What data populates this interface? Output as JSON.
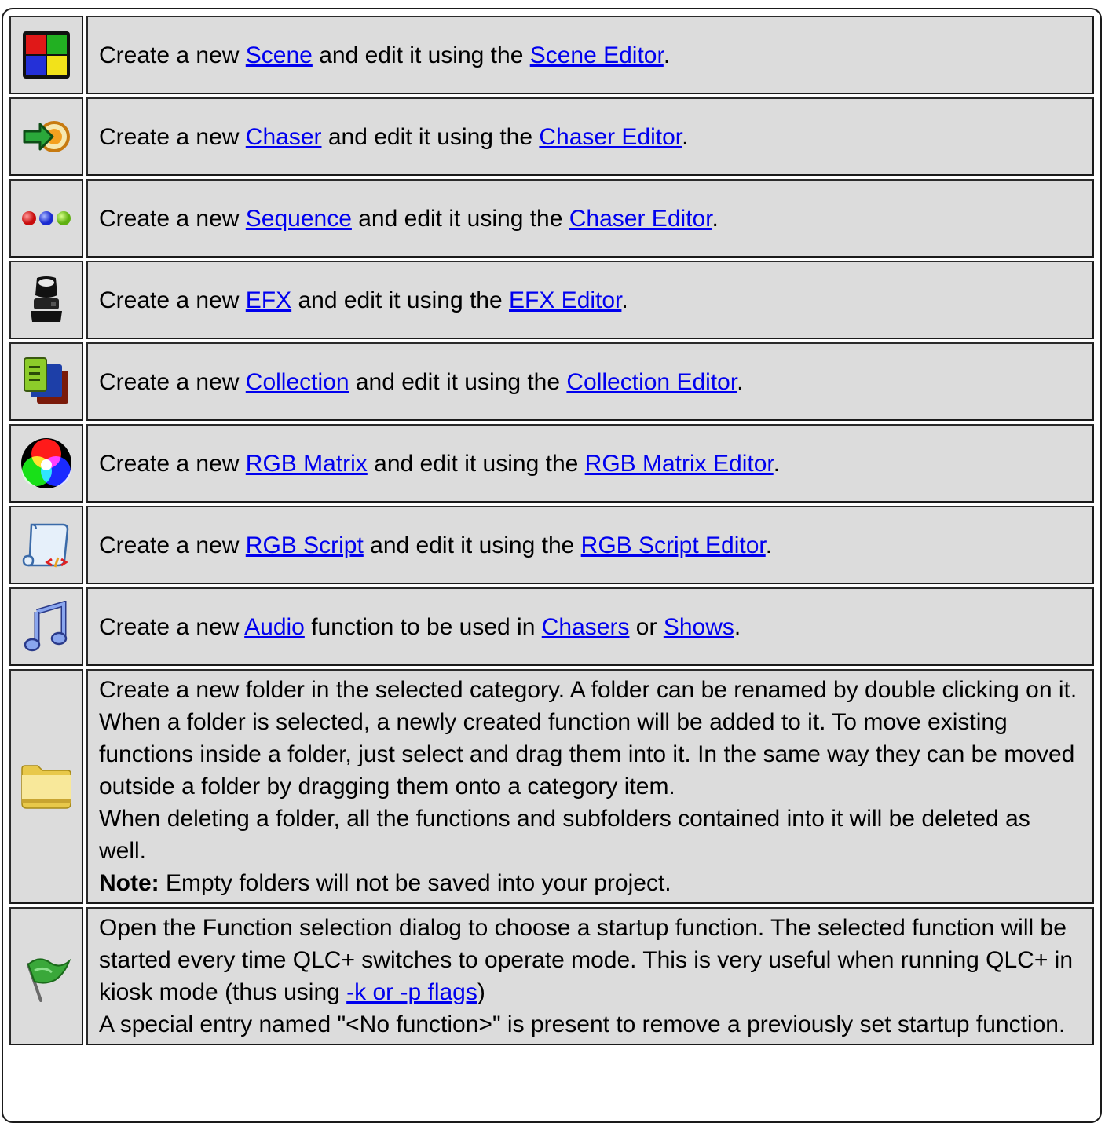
{
  "rows": [
    {
      "icon": "scene-icon",
      "prefix": "Create a new ",
      "link1": "Scene",
      "middle": " and edit it using the ",
      "link2": "Scene Editor",
      "suffix": "."
    },
    {
      "icon": "chaser-icon",
      "prefix": "Create a new ",
      "link1": "Chaser",
      "middle": " and edit it using the ",
      "link2": "Chaser Editor",
      "suffix": "."
    },
    {
      "icon": "sequence-icon",
      "prefix": "Create a new ",
      "link1": "Sequence",
      "middle": " and edit it using the ",
      "link2": "Chaser Editor",
      "suffix": "."
    },
    {
      "icon": "efx-icon",
      "prefix": "Create a new ",
      "link1": "EFX",
      "middle": " and edit it using the ",
      "link2": "EFX Editor",
      "suffix": "."
    },
    {
      "icon": "collection-icon",
      "prefix": "Create a new ",
      "link1": "Collection",
      "middle": " and edit it using the ",
      "link2": "Collection Editor",
      "suffix": "."
    },
    {
      "icon": "rgb-matrix-icon",
      "prefix": "Create a new ",
      "link1": "RGB Matrix",
      "middle": " and edit it using the ",
      "link2": "RGB Matrix Editor",
      "suffix": "."
    },
    {
      "icon": "rgb-script-icon",
      "prefix": "Create a new ",
      "link1": "RGB Script",
      "middle": " and edit it using the ",
      "link2": "RGB Script Editor",
      "suffix": "."
    }
  ],
  "audio": {
    "icon": "audio-icon",
    "prefix": "Create a new ",
    "link1": "Audio",
    "middle": " function to be used in ",
    "link2": "Chasers",
    "or": " or ",
    "link3": "Shows",
    "suffix": "."
  },
  "folder": {
    "icon": "folder-icon",
    "p1": "Create a new folder in the selected category. A folder can be renamed by double clicking on it.",
    "p2": "When a folder is selected, a newly created function will be added to it. To move existing functions inside a folder, just select and drag them into it. In the same way they can be moved outside a folder by dragging them onto a category item.",
    "p3": "When deleting a folder, all the functions and subfolders contained into it will be deleted as well.",
    "note_label": "Note:",
    "note_text": " Empty folders will not be saved into your project."
  },
  "startup": {
    "icon": "flag-icon",
    "p1_prefix": "Open the Function selection dialog to choose a startup function. The selected function will be started every time QLC+ switches to operate mode. This is very useful when running QLC+ in kiosk mode (thus using ",
    "p1_link": "-k or -p flags",
    "p1_suffix": ")",
    "p2": "A special entry named \"<No function>\" is present to remove a previously set startup function."
  }
}
